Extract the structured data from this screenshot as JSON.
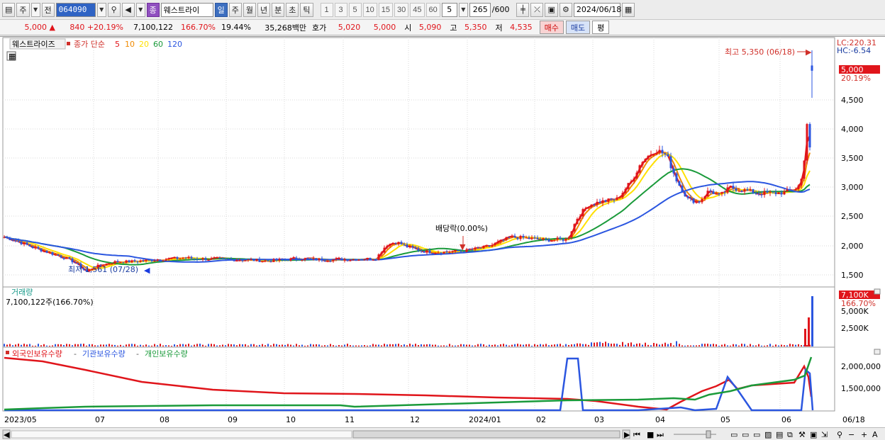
{
  "toolbar": {
    "market_label": "주",
    "mode_label": "전",
    "stock_code": "064090",
    "stock_name": "웨스트라이",
    "name_badge": "종",
    "period_tabs": [
      "일",
      "주",
      "월",
      "년",
      "분",
      "초",
      "틱"
    ],
    "active_period": "일",
    "interval_options": [
      "1",
      "3",
      "5",
      "10",
      "15",
      "30",
      "45",
      "60"
    ],
    "interval_value": "5",
    "count_display": "265",
    "count_total": "/600",
    "date": "2024/06/18"
  },
  "quote": {
    "price": "5,000",
    "change": "840",
    "change_rate": "+20.19%",
    "volume": "7,100,122",
    "volume_ratio": "166.70%",
    "turnover": "19.44%",
    "amount": "35,268백만",
    "bid_label": "호가",
    "bid1": "5,020",
    "bid2": "5,000",
    "open_label": "시",
    "open": "5,090",
    "high_label": "고",
    "high": "5,350",
    "low_label": "저",
    "low": "4,535",
    "buy_label": "매수",
    "sell_label": "매도",
    "flat_label": "평"
  },
  "price_panel": {
    "title": "웨스트라이즈",
    "legend_prefix": "종가 단순",
    "ma_labels": [
      "5",
      "10",
      "20",
      "60",
      "120"
    ],
    "ma_colors": [
      "#e0151b",
      "#f08a00",
      "#ffe000",
      "#1a9a3a",
      "#2b56e0"
    ],
    "lc": "LC:220.31",
    "hc": "HC:-6.54",
    "high_note": "최고 5,350 (06/18)",
    "low_note": "최저 1,561 (07/28)",
    "dividend_note": "배당락(0.00%)",
    "price_tag": "5,000",
    "price_tag_rate": "20.19%",
    "y_ticks": [
      "4,500",
      "4,000",
      "3,500",
      "3,000",
      "2,500",
      "2,000",
      "1,500"
    ]
  },
  "volume_panel": {
    "title": "거래량",
    "value": "7,100,122주(166.70%)",
    "tag": "7,100K",
    "tag_rate": "166.70%",
    "y_ticks": [
      "5,000K",
      "2,500K"
    ]
  },
  "holding_panel": {
    "legend": [
      "외국인보유수량",
      "기관보유수량",
      "개인보유수량"
    ],
    "legend_colors": [
      "#e0151b",
      "#2b56e0",
      "#1a9a3a"
    ],
    "y_ticks": [
      "2,000,000",
      "1,500,000"
    ]
  },
  "x_axis": {
    "labels": [
      "2023/05",
      "07",
      "08",
      "09",
      "10",
      "11",
      "12",
      "2024/01",
      "02",
      "03",
      "04",
      "05",
      "06"
    ],
    "end_label": "06/18"
  }
}
